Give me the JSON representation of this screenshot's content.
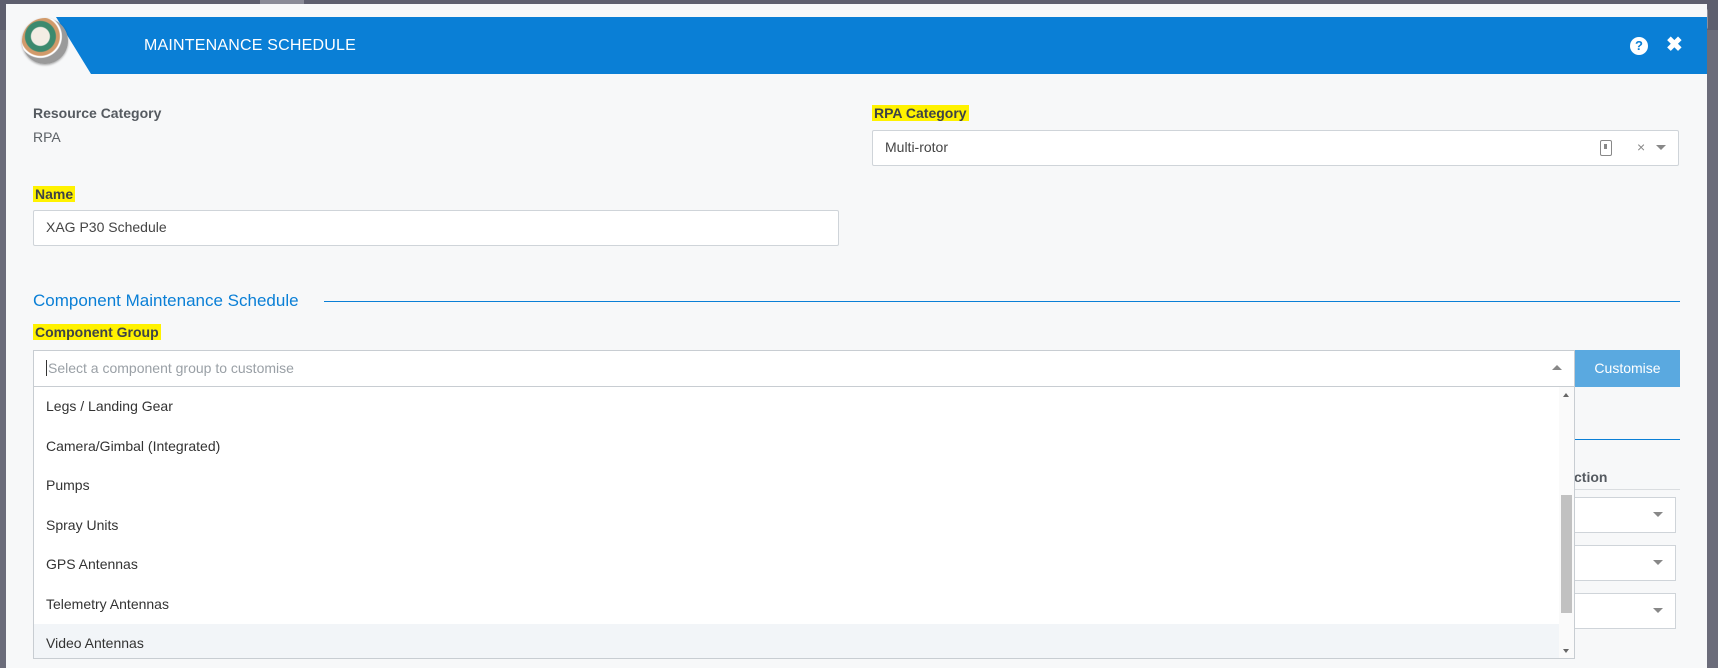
{
  "header": {
    "title": "MAINTENANCE SCHEDULE",
    "help_icon_glyph": "?",
    "close_icon_glyph": "✖"
  },
  "resource_category": {
    "label": "Resource Category",
    "value": "RPA"
  },
  "rpa_category": {
    "label": "RPA Category",
    "value": "Multi-rotor",
    "clear_glyph": "×"
  },
  "name_field": {
    "label": "Name",
    "value": "XAG P30 Schedule"
  },
  "section": {
    "title": "Component Maintenance Schedule"
  },
  "component_group": {
    "label": "Component Group",
    "placeholder": "Select a component group to customise",
    "customise_label": "Customise",
    "options": [
      "Legs / Landing Gear",
      "Camera/Gimbal (Integrated)",
      "Pumps",
      "Spray Units",
      "GPS Antennas",
      "Telemetry Antennas",
      "Video Antennas"
    ],
    "hovered_option": "Video Antennas"
  },
  "background_table": {
    "partial_header": "ction"
  },
  "colors": {
    "accent": "#0a7fd6",
    "highlight": "#fff200",
    "button": "#5aa9e0"
  }
}
